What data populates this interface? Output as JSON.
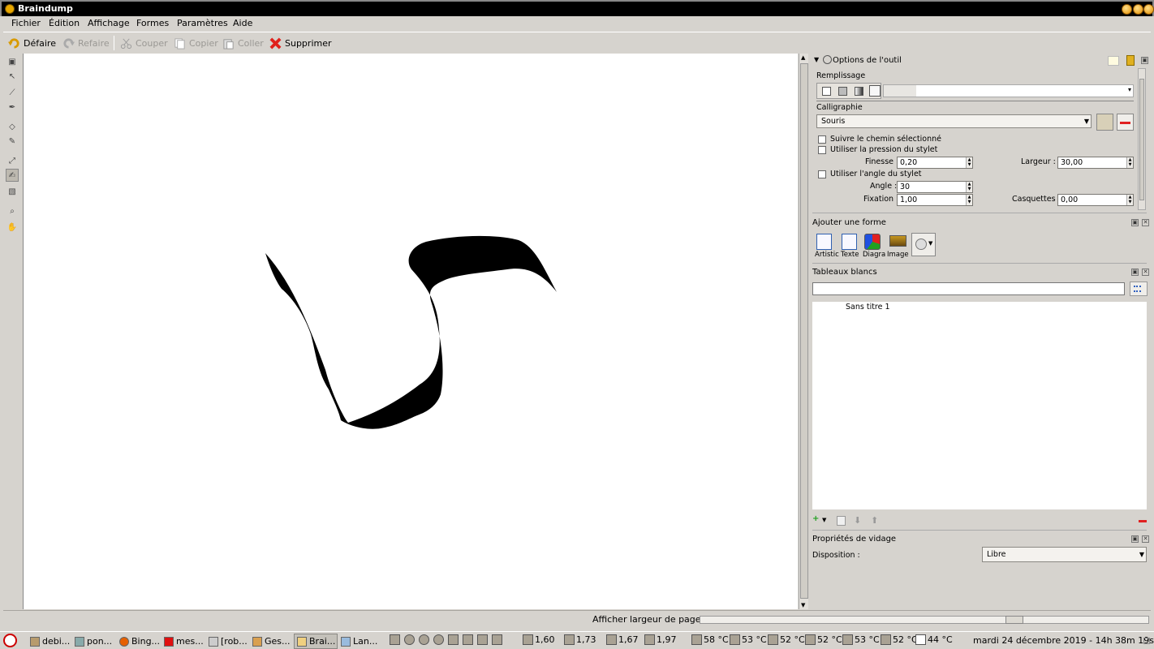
{
  "window": {
    "title": "Braindump"
  },
  "menu": [
    "Fichier",
    "Édition",
    "Affichage",
    "Formes",
    "Paramètres",
    "Aide"
  ],
  "toolbar": {
    "undo": "Défaire",
    "redo": "Refaire",
    "cut": "Couper",
    "copy": "Copier",
    "paste": "Coller",
    "delete": "Supprimer"
  },
  "tool_options": {
    "title": "Options de l'outil",
    "fill_label": "Remplissage",
    "calligraphy_label": "Calligraphie",
    "calligraphy_value": "Souris",
    "follow_path": "Suivre le chemin sélectionné",
    "use_pressure": "Utiliser la pression du stylet",
    "thinning_label": "Finesse :",
    "thinning_value": "0,20",
    "width_label": "Largeur :",
    "width_value": "30,00",
    "use_angle": "Utiliser l'angle du stylet",
    "angle_label": "Angle :",
    "angle_value": "30",
    "fixation_label": "Fixation :",
    "fixation_value": "1,00",
    "caps_label": "Casquettes :",
    "caps_value": "0,00"
  },
  "add_shape": {
    "title": "Ajouter une forme",
    "items": [
      "Artistic",
      "Texte",
      "Diagra",
      "Image"
    ]
  },
  "whiteboards": {
    "title": "Tableaux blancs",
    "search_value": "",
    "items": [
      "Sans titre 1"
    ]
  },
  "layout_props": {
    "title": "Propriétés de vidage",
    "disposition_label": "Disposition :",
    "disposition_value": "Libre"
  },
  "statusbar": {
    "message": "Afficher largeur de page"
  },
  "taskbar": {
    "tasks": [
      "debi...",
      "pon...",
      "Bing...",
      "mes...",
      "[rob...",
      "Ges...",
      "Brai...",
      "Lan..."
    ],
    "tray_values": [
      "1,60",
      "1,73",
      "1,67",
      "1,97"
    ],
    "temps": [
      "58 °C",
      "53 °C",
      "52 °C",
      "52 °C",
      "53 °C",
      "52 °C",
      "44 °C"
    ],
    "clock": "mardi 24 décembre 2019 - 14h 38m 19s"
  }
}
